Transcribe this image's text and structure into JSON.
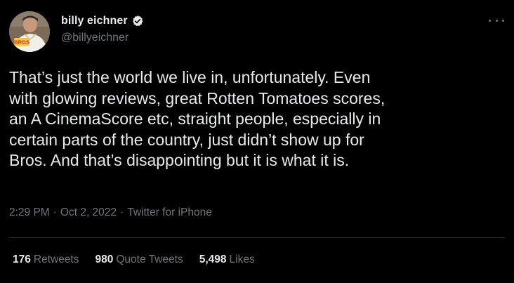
{
  "author": {
    "display_name": "billy eichner",
    "handle": "@billyeichner",
    "verified": true,
    "avatar_shirt_text": "BROS"
  },
  "tweet": {
    "text": "That’s just the world we live in, unfortunately. Even\nwith glowing reviews, great Rotten Tomatoes scores,\nan A CinemaScore etc, straight people, especially in\ncertain parts of the country, just didn’t show up for\nBros. And that’s disappointing but it is what it is.",
    "time": "2:29 PM",
    "date": "Oct 2, 2022",
    "source": "Twitter for iPhone",
    "separator": "·"
  },
  "stats": {
    "retweets_count": "176",
    "retweets_label": "Retweets",
    "quotes_count": "980",
    "quotes_label": "Quote Tweets",
    "likes_count": "5,498",
    "likes_label": "Likes"
  },
  "colors": {
    "background": "#000000",
    "primary_text": "#e7e9ea",
    "secondary_text": "#71767b",
    "verified_badge": "#e7e9ea",
    "divider": "#2f3336"
  },
  "icons": {
    "verified": "verified-badge-icon",
    "more": "more-options-icon"
  }
}
